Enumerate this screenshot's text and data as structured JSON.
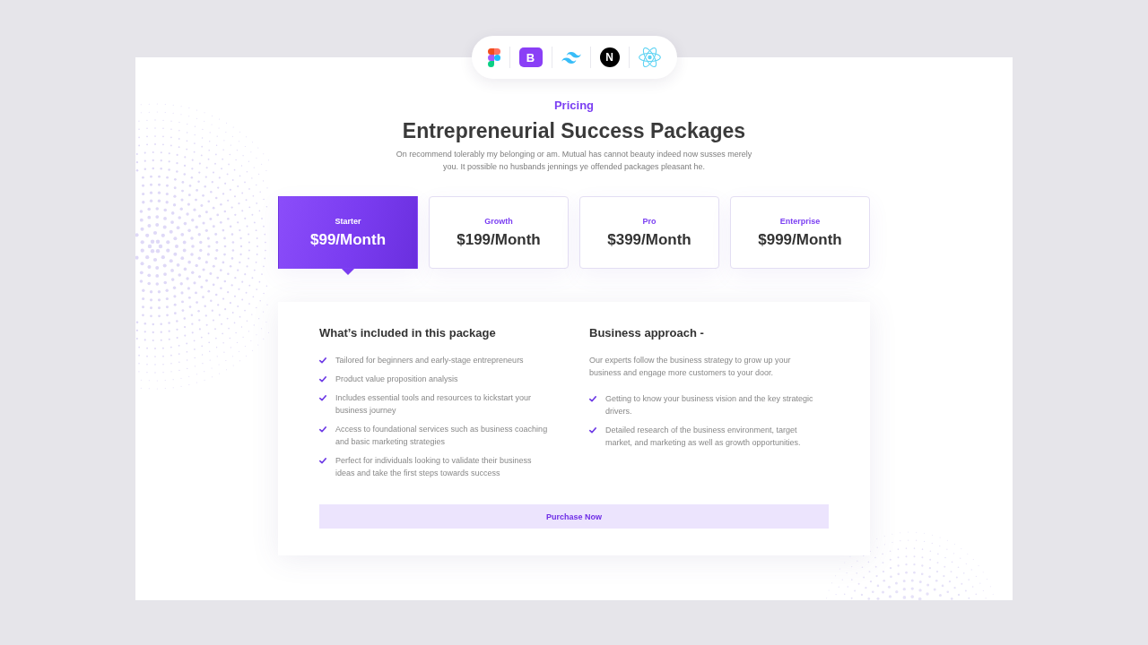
{
  "tool_logos": [
    {
      "kind": "figma"
    },
    {
      "kind": "bootstrap",
      "letter": "B"
    },
    {
      "kind": "tailwind"
    },
    {
      "kind": "nextjs",
      "letter": "N"
    },
    {
      "kind": "react"
    }
  ],
  "eyebrow": "Pricing",
  "title": "Entrepreneurial Success Packages",
  "description": "On recommend tolerably my belonging or am. Mutual has cannot beauty indeed now susses merely you. It possible no husbands jennings ye offended packages pleasant he.",
  "plans": [
    {
      "name": "Starter",
      "price": "$99/Month",
      "selected": true
    },
    {
      "name": "Growth",
      "price": "$199/Month",
      "selected": false
    },
    {
      "name": "Pro",
      "price": "$399/Month",
      "selected": false
    },
    {
      "name": "Enterprise",
      "price": "$999/Month",
      "selected": false
    }
  ],
  "package_details": {
    "included": {
      "heading": "What’s included in this package",
      "items": [
        "Tailored for beginners and early-stage entrepreneurs",
        "Product value proposition analysis",
        "Includes essential tools and resources to kickstart your business journey",
        "Access to foundational services such as business coaching and basic marketing strategies",
        "Perfect for individuals looking to validate their business ideas and take the first steps towards success"
      ]
    },
    "approach": {
      "heading": "Business approach -",
      "intro": "Our experts follow the business strategy to grow up your business and engage more customers to your door.",
      "items": [
        "Getting to know your business vision and the key strategic drivers.",
        "Detailed research of the business environment, target market, and marketing as well as growth opportunities."
      ]
    },
    "purchase_button": "Purchase Now"
  }
}
